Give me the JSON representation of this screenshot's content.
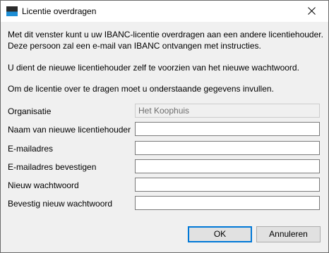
{
  "window": {
    "title": "Licentie overdragen"
  },
  "intro": {
    "line1": "Met dit venster kunt u uw IBANC-licentie overdragen aan een andere licentiehouder.",
    "line2": "Deze persoon zal een e-mail van IBANC ontvangen met instructies.",
    "line3": "U dient de nieuwe licentiehouder zelf te voorzien van het nieuwe wachtwoord.",
    "line4": "Om de licentie over te dragen moet u onderstaande gegevens invullen."
  },
  "form": {
    "organisation_label": "Organisatie",
    "organisation_value": "Het Koophuis",
    "new_holder_label": "Naam van nieuwe licentiehouder",
    "new_holder_value": "",
    "email_label": "E-mailadres",
    "email_value": "",
    "email_confirm_label": "E-mailadres bevestigen",
    "email_confirm_value": "",
    "password_label": "Nieuw wachtwoord",
    "password_value": "",
    "password_confirm_label": "Bevestig nieuw wachtwoord",
    "password_confirm_value": ""
  },
  "buttons": {
    "ok_label": "OK",
    "cancel_label": "Annuleren"
  },
  "colors": {
    "default_button_border": "#0078d7",
    "icon_accent": "#1e8fd6"
  }
}
